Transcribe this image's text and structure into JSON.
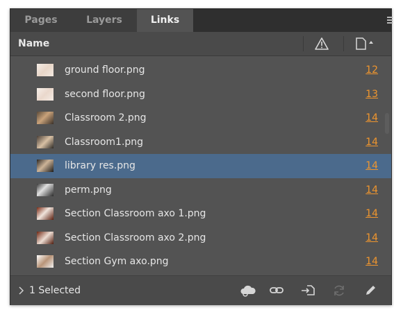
{
  "tabs": [
    {
      "label": "Pages"
    },
    {
      "label": "Layers"
    },
    {
      "label": "Links"
    }
  ],
  "header": {
    "name_label": "Name"
  },
  "links": [
    {
      "name": "ground floor.png",
      "page": "12"
    },
    {
      "name": "second floor.png",
      "page": "13"
    },
    {
      "name": "Classroom 2.png",
      "page": "14"
    },
    {
      "name": "Classroom1.png",
      "page": "14"
    },
    {
      "name": "library res.png",
      "page": "14"
    },
    {
      "name": "perm.png",
      "page": "14"
    },
    {
      "name": "Section Classroom axo 1.png",
      "page": "14"
    },
    {
      "name": "Section Classroom axo 2.png",
      "page": "14"
    },
    {
      "name": "Section Gym axo.png",
      "page": "14"
    }
  ],
  "footer": {
    "selected_text": "1 Selected"
  },
  "icons": {
    "menu": "panel-menu-icon",
    "warning": "warning-triangle-icon",
    "page": "page-icon",
    "sort": "sort-up-icon",
    "expand": "chevron-right-icon",
    "cc_libraries": "cloud-library-icon",
    "relink": "relink-icon",
    "goto": "go-to-link-icon",
    "update": "update-link-icon",
    "edit": "edit-original-icon"
  },
  "colors": {
    "panel_bg": "#535353",
    "selection": "#4b6a8c",
    "page_number": "#f0962e"
  }
}
